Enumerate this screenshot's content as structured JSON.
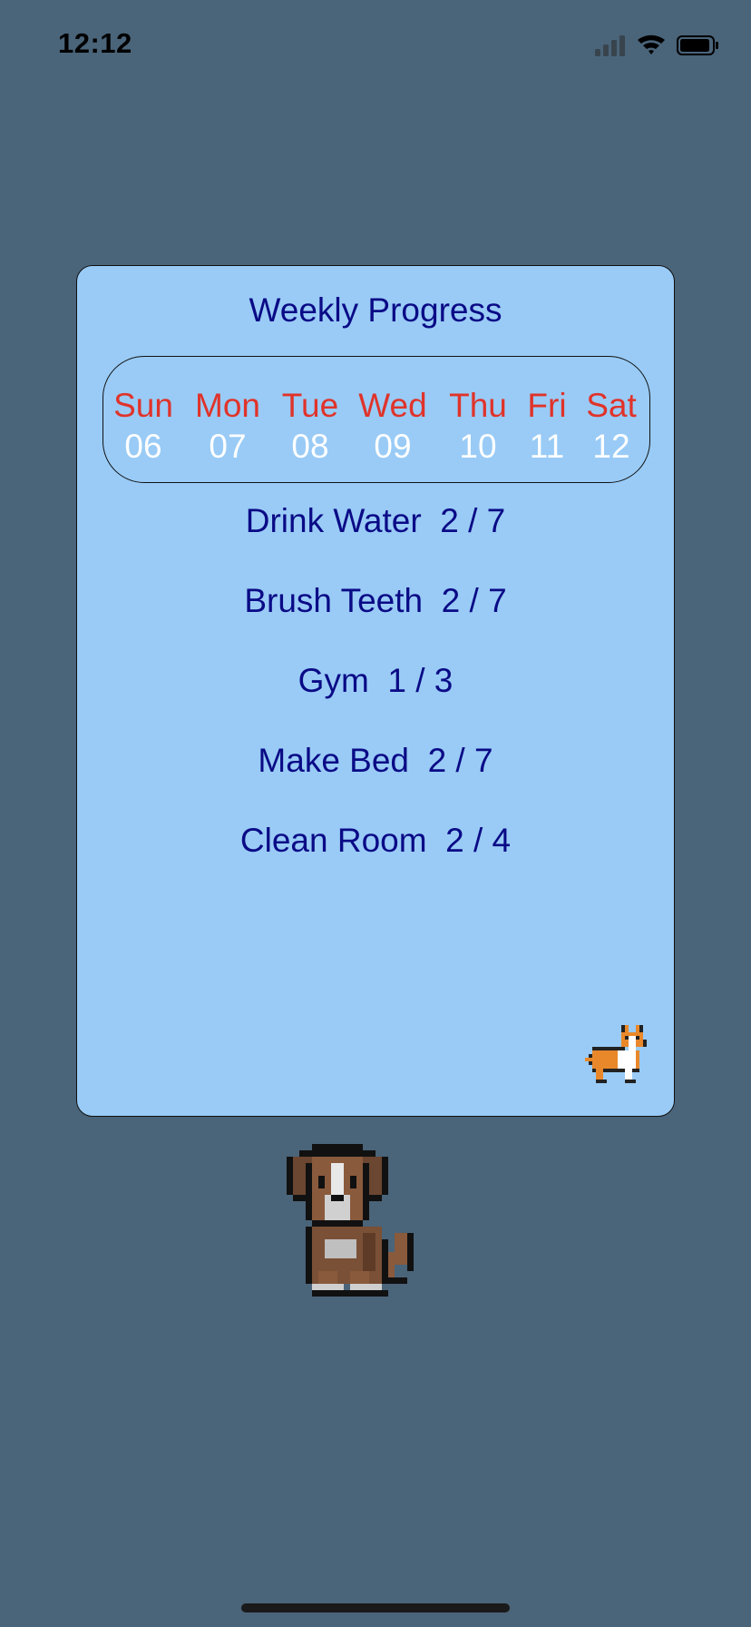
{
  "status_bar": {
    "time": "12:12"
  },
  "card": {
    "title": "Weekly Progress",
    "days": [
      {
        "name": "Sun",
        "num": "06"
      },
      {
        "name": "Mon",
        "num": "07"
      },
      {
        "name": "Tue",
        "num": "08"
      },
      {
        "name": "Wed",
        "num": "09"
      },
      {
        "name": "Thu",
        "num": "10"
      },
      {
        "name": "Fri",
        "num": "11"
      },
      {
        "name": "Sat",
        "num": "12"
      }
    ],
    "habits": [
      {
        "label": "Drink Water  2 / 7"
      },
      {
        "label": "Brush Teeth  2 / 7"
      },
      {
        "label": "Gym  1 / 3"
      },
      {
        "label": "Make Bed  2 / 7"
      },
      {
        "label": "Clean Room  2 / 4"
      }
    ]
  },
  "colors": {
    "background": "#4a6479",
    "card": "#99cbf6",
    "title_text": "#0a0a86",
    "day_name": "#e0332a",
    "day_number": "#ffffff"
  },
  "icons": {
    "cellular": "cellular-signal-icon",
    "wifi": "wifi-icon",
    "battery": "battery-icon",
    "corgi": "corgi-pet-icon",
    "puppy": "puppy-pet-image"
  }
}
